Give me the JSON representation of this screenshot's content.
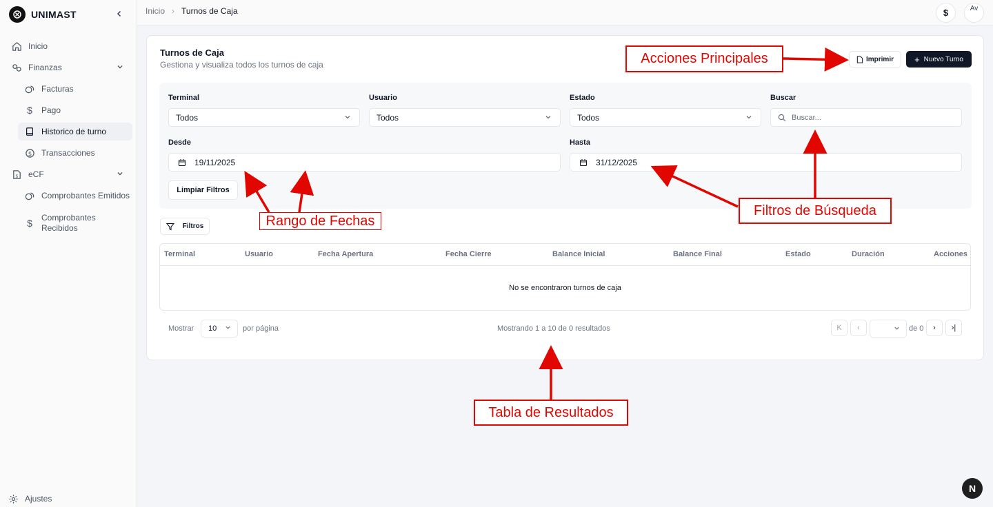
{
  "brand": {
    "name": "UNIMAST"
  },
  "sidebar": {
    "items": [
      {
        "label": "Inicio"
      },
      {
        "label": "Finanzas"
      },
      {
        "label": "Facturas"
      },
      {
        "label": "Pago"
      },
      {
        "label": "Historico de turno"
      },
      {
        "label": "Transacciones"
      },
      {
        "label": "eCF"
      },
      {
        "label": "Comprobantes Emitidos"
      },
      {
        "label": "Comprobantes Recibidos"
      }
    ],
    "settings_label": "Ajustes"
  },
  "breadcrumb": {
    "home": "Inicio",
    "current": "Turnos de Caja"
  },
  "topbar": {
    "currency_symbol": "$",
    "avatar_text": "Av"
  },
  "page": {
    "title": "Turnos de Caja",
    "subtitle": "Gestiona y visualiza todos los turnos de caja",
    "print_label": "Imprimir",
    "new_label": "Nuevo Turno"
  },
  "filters": {
    "terminal": {
      "label": "Terminal",
      "value": "Todos"
    },
    "usuario": {
      "label": "Usuario",
      "value": "Todos"
    },
    "estado": {
      "label": "Estado",
      "value": "Todos"
    },
    "buscar": {
      "label": "Buscar",
      "placeholder": "Buscar..."
    },
    "desde": {
      "label": "Desde",
      "value": "19/11/2025"
    },
    "hasta": {
      "label": "Hasta",
      "value": "31/12/2025"
    },
    "clear_label": "Limpiar Filtros",
    "toggle_label": "Filtros"
  },
  "table": {
    "columns": [
      "Terminal",
      "Usuario",
      "Fecha Apertura",
      "Fecha Cierre",
      "Balance Inicial",
      "Balance Final",
      "Estado",
      "Duración",
      "Acciones"
    ],
    "empty_message": "No se encontraron turnos de caja"
  },
  "pagination": {
    "show_label": "Mostrar",
    "page_size": "10",
    "per_page_label": "por página",
    "summary": "Mostrando 1 a 10 de 0 resultados",
    "of_label": "de 0"
  },
  "annotations": {
    "acciones": "Acciones Principales",
    "filtros": "Filtros de Búsqueda",
    "fechas": "Rango de Fechas",
    "tabla": "Tabla de Resultados"
  },
  "fab": {
    "label": "N"
  },
  "colors": {
    "annotation": "#e10600",
    "primary_button": "#101828"
  }
}
